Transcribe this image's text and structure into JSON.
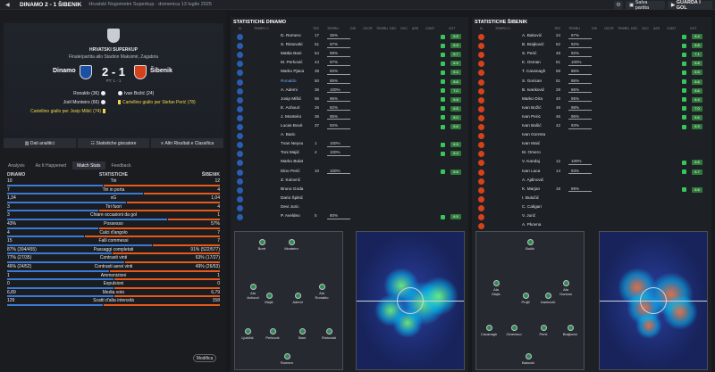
{
  "topbar": {
    "match": "DINAMO  2 - 1  ŠIBENIK",
    "competition": "Hrvatski Nogometni Superkup",
    "date": "domenica 13 luglio 2025",
    "save": "Salva partita",
    "watch": "GUARDA I GOL"
  },
  "match": {
    "competition": "HRVATSKI SUPERKUP",
    "venue": "Finale/partita allo Stadion Maksimir, Zagabria",
    "home": "Dinamo",
    "away": "Šibenik",
    "score": "2 - 1",
    "pt": "PT: 1 - 1",
    "events_home": [
      "Ronaldo (36)",
      "Joël Monteiro (66)",
      "Cartellino giallo per Josip Mišić (74)"
    ],
    "events_away": [
      "Ivan Božić (24)",
      "Cartellino giallo per Stefan Perić (78)"
    ]
  },
  "buttons": {
    "analysis": "Dati analitici",
    "player_stats": "Statistiche giocatore",
    "results": "Altri Risultati e Classifica"
  },
  "tabs": [
    "Analysis",
    "As It Happened",
    "Match Stats",
    "Feedback"
  ],
  "stats": {
    "home": "DINAMO",
    "center": "STATISTICHE",
    "away": "ŠIBENIK",
    "modifica": "Modifica",
    "rows": [
      {
        "h": "10",
        "l": "Tiri",
        "a": "12",
        "hp": 0.45
      },
      {
        "h": "7",
        "l": "Tiri in porta",
        "a": "4",
        "hp": 0.64
      },
      {
        "h": "1,34",
        "l": "xG",
        "a": "1,04",
        "hp": 0.56
      },
      {
        "h": "3",
        "l": "Tiri fuori",
        "a": "4",
        "hp": 0.43
      },
      {
        "h": "3",
        "l": "Chiare occasioni da gol",
        "a": "1",
        "hp": 0.75
      },
      {
        "h": "43%",
        "l": "Possesso",
        "a": "57%",
        "hp": 0.43
      },
      {
        "h": "4",
        "l": "Calci d'angolo",
        "a": "7",
        "hp": 0.36
      },
      {
        "h": "15",
        "l": "Falli commessi",
        "a": "7",
        "hp": 0.68
      },
      {
        "h": "87% (394/455)",
        "l": "Passaggi completati",
        "a": "91% (522/577)",
        "hp": 0.49
      },
      {
        "h": "77% (27/35)",
        "l": "Contrasti vinti",
        "a": "63% (17/27)",
        "hp": 0.55
      },
      {
        "h": "46% (24/52)",
        "l": "Contrasti aerei vinti",
        "a": "49% (26/53)",
        "hp": 0.48
      },
      {
        "h": "1",
        "l": "Ammonizioni",
        "a": "1",
        "hp": 0.5
      },
      {
        "h": "0",
        "l": "Espulsioni",
        "a": "0",
        "hp": 0.5
      },
      {
        "h": "6,89",
        "l": "Media voto",
        "a": "6,79",
        "hp": 0.5
      },
      {
        "h": "129",
        "l": "Scatti d'alta intensità",
        "a": "158",
        "hp": 0.45
      }
    ]
  },
  "dinamo": {
    "title": "STATISTICHE DINAMO",
    "cols": [
      "N.",
      "TEMPO",
      "C.",
      "TIRI",
      "TIRI/RU",
      "DIS",
      "OCCR",
      "TIRI/RU",
      "DEC",
      "OCC",
      "ASS",
      "CONT",
      "VOT"
    ],
    "players": [
      {
        "n": "1",
        "name": "D. Romero",
        "p": "17",
        "pc": "35%",
        "r": "6.5"
      },
      {
        "n": "",
        "name": "S. Ristovski",
        "p": "51",
        "pc": "97%",
        "r": "6.9"
      },
      {
        "n": "",
        "name": "Mattia Bani",
        "p": "54",
        "pc": "98%",
        "r": "6.7"
      },
      {
        "n": "",
        "name": "M. Perković",
        "p": "44",
        "pc": "97%",
        "r": "6.9"
      },
      {
        "n": "",
        "name": "Marko Pjaca",
        "p": "38",
        "pc": "92%",
        "r": "6.4"
      },
      {
        "n": "",
        "name": "Ronaldo",
        "p": "50",
        "pc": "85%",
        "r": "8.6"
      },
      {
        "n": "",
        "name": "A. Ademi",
        "p": "36",
        "pc": "100%",
        "r": "7.0"
      },
      {
        "n": "",
        "name": "Josip Mišić",
        "p": "56",
        "pc": "96%",
        "r": "6.8"
      },
      {
        "n": "",
        "name": "E. Achouri",
        "p": "26",
        "pc": "92%",
        "r": "6.5"
      },
      {
        "n": "",
        "name": "J. Monteiro",
        "p": "36",
        "pc": "95%",
        "r": "8.0"
      },
      {
        "n": "",
        "name": "Lucas Bovè",
        "p": "37",
        "pc": "92%",
        "r": "6.6"
      },
      {
        "n": "",
        "name": "A. Baric",
        "p": "",
        "pc": "",
        "r": ""
      },
      {
        "n": "",
        "name": "Tvan Neyou",
        "p": "1",
        "pc": "100%",
        "r": "6.5"
      },
      {
        "n": "",
        "name": "Toni Majić",
        "p": "4",
        "pc": "100%",
        "r": "6.4"
      },
      {
        "n": "",
        "name": "Marko Bulat",
        "p": "",
        "pc": "",
        "r": ""
      },
      {
        "n": "",
        "name": "Dino Perić",
        "p": "10",
        "pc": "100%",
        "r": "6.6"
      },
      {
        "n": "",
        "name": "Z. Kolovrić",
        "p": "",
        "pc": "",
        "r": ""
      },
      {
        "n": "",
        "name": "Bruno Goda",
        "p": "",
        "pc": "",
        "r": ""
      },
      {
        "n": "",
        "name": "Dario Špikić",
        "p": "",
        "pc": "",
        "r": ""
      },
      {
        "n": "",
        "name": "Devi Juric",
        "p": "",
        "pc": "",
        "r": ""
      },
      {
        "n": "",
        "name": "P. Aveldeo",
        "p": "5",
        "pc": "80%",
        "r": "6.5"
      }
    ]
  },
  "sibenik": {
    "title": "STATISTICHE ŠIBENIK",
    "cols": [
      "N.",
      "TEMPO",
      "C.",
      "TIRI",
      "TIRI/RU",
      "DIS",
      "OCCR",
      "TIRI/RU",
      "DEC",
      "OCC",
      "ASS",
      "CONT",
      "VOT"
    ],
    "players": [
      {
        "name": "A. Baković",
        "p": "24",
        "pc": "87%",
        "r": "6.4"
      },
      {
        "name": "B. Brajković",
        "p": "62",
        "pc": "92%",
        "r": "6.8"
      },
      {
        "name": "S. Perić",
        "p": "48",
        "pc": "92%",
        "r": "7.1"
      },
      {
        "name": "K. Osman",
        "p": "51",
        "pc": "100%",
        "r": "6.8"
      },
      {
        "name": "T. Cavanagh",
        "p": "58",
        "pc": "86%",
        "r": "6.5"
      },
      {
        "name": "S. Gorican",
        "p": "51",
        "pc": "86%",
        "r": "6.6"
      },
      {
        "name": "B. Ivanković",
        "p": "29",
        "pc": "86%",
        "r": "6.6"
      },
      {
        "name": "Marko Dira",
        "p": "40",
        "pc": "95%",
        "r": "6.4"
      },
      {
        "name": "Ivan Božić",
        "p": "49",
        "pc": "98%",
        "r": "7.0"
      },
      {
        "name": "Ivan Peric",
        "p": "46",
        "pc": "96%",
        "r": "6.6"
      },
      {
        "name": "Ivan Bašić",
        "p": "42",
        "pc": "93%",
        "r": "6.9"
      },
      {
        "name": "Ivan Gorreta",
        "p": "",
        "pc": "",
        "r": ""
      },
      {
        "name": "Ivan Maić",
        "p": "",
        "pc": "",
        "r": ""
      },
      {
        "name": "M. Omero",
        "p": "",
        "pc": "",
        "r": ""
      },
      {
        "name": "V. Kandaj",
        "p": "12",
        "pc": "100%",
        "r": "6.6"
      },
      {
        "name": "Ivan Laca",
        "p": "14",
        "pc": "93%",
        "r": "6.7"
      },
      {
        "name": "A. Ajdinović",
        "p": "",
        "pc": "",
        "r": ""
      },
      {
        "name": "K. Marjan",
        "p": "18",
        "pc": "89%",
        "r": "6.6"
      },
      {
        "name": "I. Bulučić",
        "p": "",
        "pc": "",
        "r": ""
      },
      {
        "name": "C. Caligari",
        "p": "",
        "pc": "",
        "r": ""
      },
      {
        "name": "V. Jurić",
        "p": "",
        "pc": "",
        "r": ""
      },
      {
        "name": "A. Pkovna",
        "p": "",
        "pc": "",
        "r": ""
      }
    ]
  },
  "formation_dinamo": [
    {
      "nm": "Boré"
    },
    {
      "nm": "Monteiro"
    },
    {
      "nm": "Ala\nAchouri"
    },
    {
      "nm": "Ala\nRonaldo"
    },
    {
      "nm": "Majić"
    },
    {
      "nm": "Ademi"
    },
    {
      "nm": "Ljubičić"
    },
    {
      "nm": "Perković"
    },
    {
      "nm": "Bani"
    },
    {
      "nm": "Ristovski"
    },
    {
      "nm": "Romero"
    }
  ],
  "formation_sibenik": [
    {
      "nm": "Božić"
    },
    {
      "nm": "Ala\nMajić"
    },
    {
      "nm": "Ala\nGorican"
    },
    {
      "nm": "Projti"
    },
    {
      "nm": "Ivanković"
    },
    {
      "nm": "Cavanagh"
    },
    {
      "nm": "Omerisco"
    },
    {
      "nm": "Perić"
    },
    {
      "nm": "Brajković"
    },
    {
      "nm": "Baković"
    }
  ],
  "colors": {
    "home_bar": "#3a7bd5",
    "away_bar": "#e85a1c",
    "rating": "#2f7a3a",
    "heart": "#36c75a",
    "heat_base": "#1b2a6a"
  }
}
